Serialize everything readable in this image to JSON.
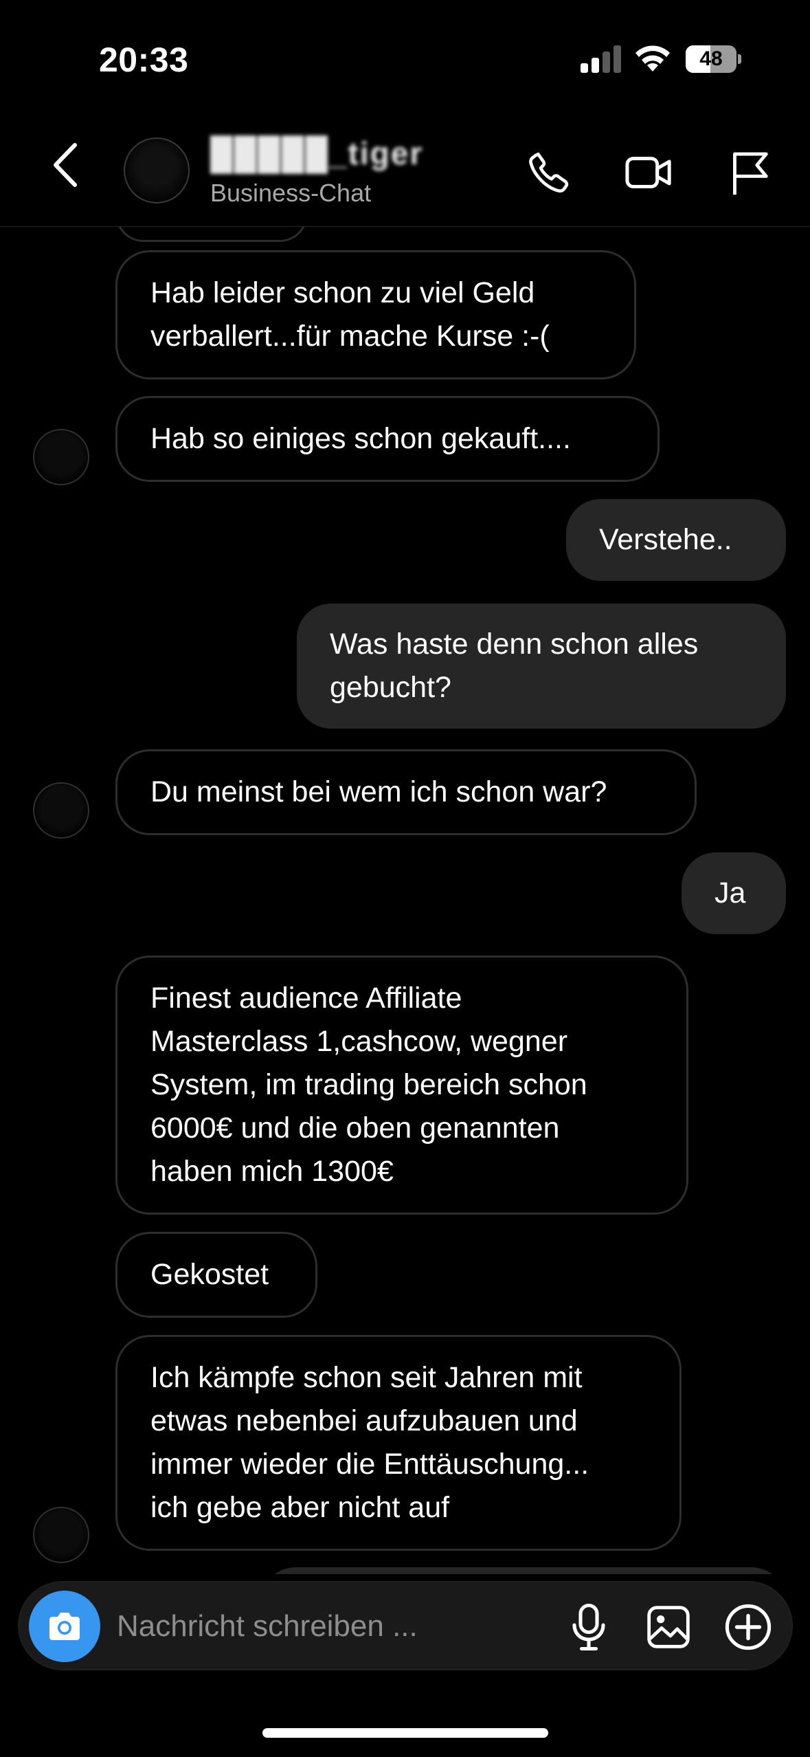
{
  "status_bar": {
    "time": "20:33",
    "battery_percent": "48",
    "battery_level": 0.48,
    "signal_bars_active": 2,
    "signal_bars_total": 4
  },
  "header": {
    "back_icon": "chevron-left-icon",
    "contact_name": "█████_tiger",
    "contact_subtitle": "Business-Chat",
    "actions": [
      "phone-icon",
      "video-camera-icon",
      "flag-icon"
    ]
  },
  "messages": [
    {
      "direction": "in",
      "text": "Hab leider schon zu viel Geld\nverballert...für mache Kurse :-("
    },
    {
      "direction": "in",
      "text": "Hab so einiges schon gekauft...."
    },
    {
      "direction": "out",
      "text": "Verstehe.."
    },
    {
      "direction": "out",
      "text": "Was haste denn schon alles\ngebucht?"
    },
    {
      "direction": "in",
      "text": "Du meinst bei wem ich schon war?"
    },
    {
      "direction": "out",
      "text": "Ja"
    },
    {
      "direction": "in",
      "text": "Finest audience  Affiliate\nMasterclass 1,cashcow, wegner\nSystem, im trading bereich schon\n6000€ und die oben genannten\nhaben mich 1300€"
    },
    {
      "direction": "in",
      "text": "Gekostet"
    },
    {
      "direction": "in",
      "text": "Ich kämpfe schon seit Jahren mit\netwas nebenbei aufzubauen und\nimmer wieder die Enttäuschung...\nich gebe aber nicht auf"
    }
  ],
  "composer": {
    "placeholder": "Nachricht schreiben ...",
    "value": "",
    "camera_icon": "camera-icon",
    "mic_icon": "microphone-icon",
    "gallery_icon": "image-icon",
    "plus_icon": "plus-circle-icon"
  },
  "colors": {
    "background": "#000000",
    "incoming_border": "#2d2d2d",
    "outgoing_bubble": "#262626",
    "camera_button": "#3797f0",
    "subtitle": "#a8a8a8",
    "placeholder": "#8e8e8e"
  }
}
